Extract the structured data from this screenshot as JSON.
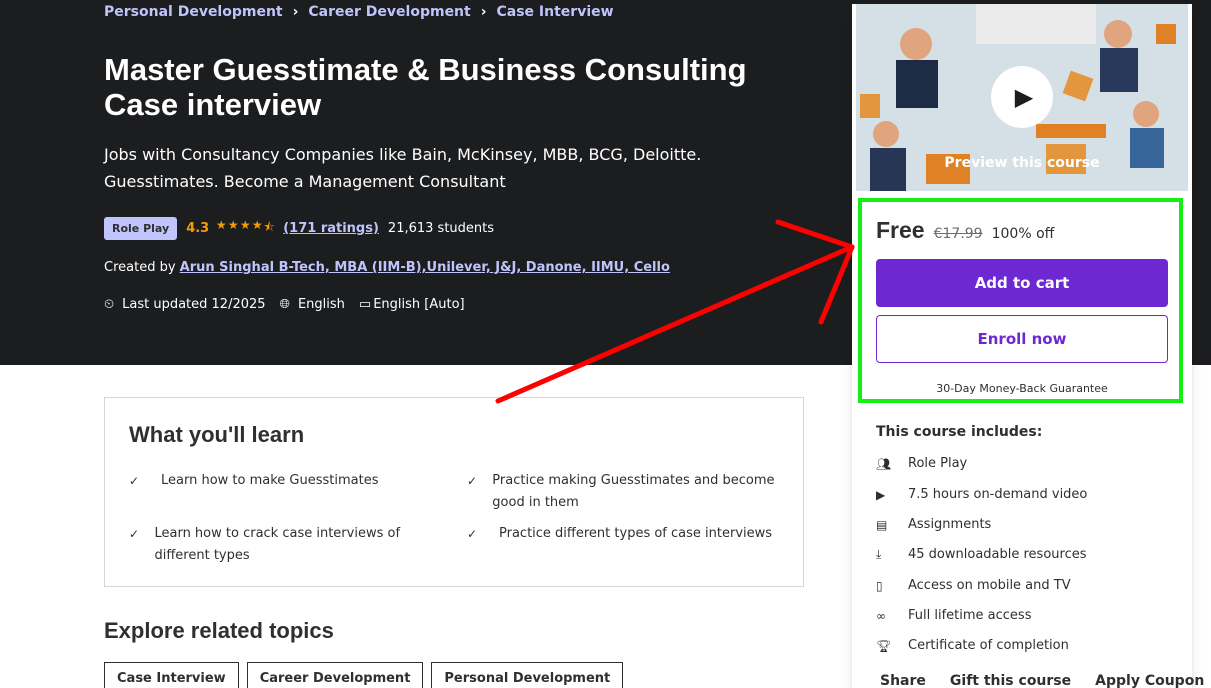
{
  "breadcrumb": [
    "Personal Development",
    "Career Development",
    "Case Interview"
  ],
  "course": {
    "title": "Master Guesstimate & Business Consulting Case interview",
    "subtitle": "Jobs with Consultancy Companies like Bain, McKinsey, MBB, BCG, Deloitte. Guesstimates. Become a Management Consultant",
    "badge": "Role Play",
    "rating": "4.3",
    "ratings_count": "(171 ratings)",
    "students": "21,613 students",
    "created_by_label": "Created by",
    "author": "Arun Singhal B-Tech, MBA (IIM-B),Unilever, J&J, Danone, IIMU, Cello",
    "last_updated": "Last updated 12/2025",
    "language": "English",
    "captions": "English [Auto]"
  },
  "learn": {
    "title": "What you'll learn",
    "items": [
      "Learn how to make Guesstimates",
      "Practice making Guesstimates and become good in them",
      "Learn how to crack case interviews of different types",
      "Practice different types of case interviews"
    ]
  },
  "explore": {
    "title": "Explore related topics",
    "topics": [
      "Case Interview",
      "Career Development",
      "Personal Development"
    ]
  },
  "sidebar": {
    "preview_label": "Preview this course",
    "price": "Free",
    "original_price": "€17.99",
    "discount": "100% off",
    "add_to_cart": "Add to cart",
    "enroll_now": "Enroll now",
    "guarantee": "30-Day Money-Back Guarantee",
    "includes_title": "This course includes:",
    "includes": [
      {
        "icon": "role-play-icon",
        "label": "Role Play"
      },
      {
        "icon": "video-icon",
        "label": "7.5 hours on-demand video"
      },
      {
        "icon": "assignment-icon",
        "label": "Assignments"
      },
      {
        "icon": "download-icon",
        "label": "45 downloadable resources"
      },
      {
        "icon": "mobile-icon",
        "label": "Access on mobile and TV"
      },
      {
        "icon": "infinity-icon",
        "label": "Full lifetime access"
      },
      {
        "icon": "trophy-icon",
        "label": "Certificate of completion"
      }
    ],
    "links": [
      "Share",
      "Gift this course",
      "Apply Coupon"
    ]
  },
  "colors": {
    "hero_bg": "#1c1d1f",
    "accent": "#6d28d2",
    "link": "#c0c4fc",
    "star": "#f69c08",
    "highlight": "#14f014",
    "annotation_arrow": "#ff0000"
  }
}
